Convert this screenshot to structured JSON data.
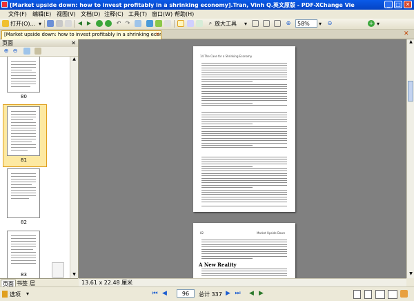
{
  "window": {
    "title": "[Market upside down: how to invest profitably in a shrinking economy].Tran, Vinh Q.英文原版 - PDF-XChange Viewer",
    "minimize": "_",
    "maximize": "□",
    "close": "✕"
  },
  "menu": [
    "文件(F)",
    "编辑(E)",
    "视图(V)",
    "文档(D)",
    "注释(C)",
    "工具(T)",
    "窗口(W)",
    "帮助(H)"
  ],
  "toolbar": {
    "open_label": "打开(O)...",
    "zoom_tool_label": "放大工具",
    "zoom_level": "58%"
  },
  "doc_tab": {
    "label": "[Market upside down: how to invest profitably in a shrinking economy].Tran, Vinh Q."
  },
  "side_panel": {
    "title": "页面",
    "thumbnails": [
      {
        "label": "80"
      },
      {
        "label": "81"
      },
      {
        "label": "82"
      },
      {
        "label": "83"
      }
    ],
    "bottom_tabs": [
      "页面",
      "书签",
      "层"
    ]
  },
  "page1": {
    "header": "14   The Case for a Shrinking Economy"
  },
  "page2": {
    "header_left": "82",
    "header_right": "Market Upside Down",
    "section_heading": "A New Reality"
  },
  "status": {
    "page_size": "13.61 x 22.48 厘米",
    "options_label": "选项",
    "current_page": "96",
    "total_pages": "总计 337"
  }
}
